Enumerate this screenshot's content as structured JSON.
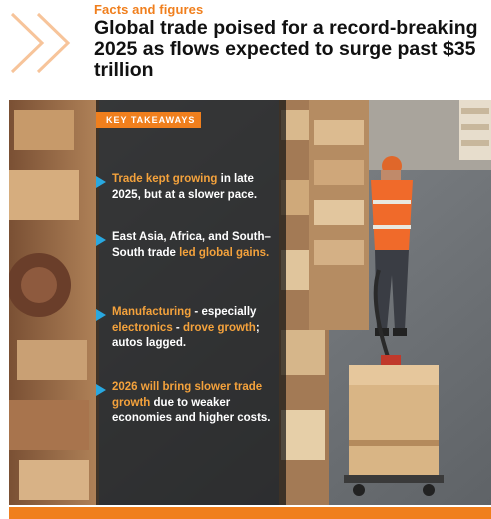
{
  "header": {
    "kicker": "Facts and figures",
    "title": "Global trade poised for a record-breaking 2025 as flows expected to surge past $35 trillion"
  },
  "key_takeaways": {
    "label": "KEY TAKEAWAYS",
    "items": [
      {
        "highlight_1": "Trade kept growing",
        "text_1": " in late 2025, but at a slower pace."
      },
      {
        "text_1": "East Asia, Africa, and South–South trade ",
        "highlight_1": "led global gains."
      },
      {
        "highlight_1": "Manufacturing",
        "text_1": " - especially ",
        "highlight_2": "electronics",
        "text_2": " - ",
        "highlight_3": "drove growth",
        "text_3": "; autos lagged."
      },
      {
        "highlight_1": "2026 will bring slower trade growth",
        "text_1": " due to weaker economies and higher costs."
      }
    ]
  },
  "colors": {
    "accent_orange": "#f07f1d",
    "highlight_orange": "#f4a23c",
    "bullet_blue": "#29a8e0",
    "headline": "#111111"
  }
}
